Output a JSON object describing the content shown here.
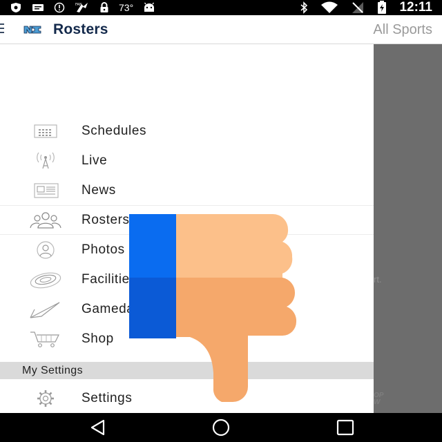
{
  "status_bar": {
    "temperature": "73°",
    "time": "12:11",
    "icons": [
      "shield-icon",
      "message-icon",
      "alert-icon",
      "fantasy-icon",
      "lock-icon",
      "android-icon",
      "bluetooth-icon",
      "wifi-icon",
      "signal-icon",
      "battery-icon"
    ]
  },
  "app_bar": {
    "title": "Rosters",
    "action": "All Sports",
    "logo": "unc-logo-icon"
  },
  "drawer": {
    "items": [
      {
        "label": "Schedules",
        "icon": "calendar-icon"
      },
      {
        "label": "Live",
        "icon": "broadcast-antenna-icon"
      },
      {
        "label": "News",
        "icon": "newspaper-icon"
      },
      {
        "label": "Rosters",
        "icon": "people-icon",
        "active": true
      },
      {
        "label": "Photos",
        "icon": "photo-person-icon"
      },
      {
        "label": "Facilities",
        "icon": "stadium-icon"
      },
      {
        "label": "Gameday",
        "icon": "pennant-icon"
      },
      {
        "label": "Shop",
        "icon": "shopping-cart-icon"
      }
    ],
    "section_header": "My Settings",
    "settings_item": {
      "label": "Settings",
      "icon": "gear-icon"
    }
  },
  "background_fragments": {
    "text_1": "rt.",
    "text_2": "OP\nW"
  },
  "overlay": {
    "icon": "thumbs-down-icon",
    "colors": {
      "cuff": "#0a6cf0",
      "cuff_shadow": "#0b5ad6",
      "hand": "#fcc08a",
      "hand_shadow": "#f5a86b"
    }
  },
  "nav_bar": {
    "icons": [
      "back-icon",
      "home-icon",
      "recents-icon"
    ]
  },
  "colors": {
    "brand_navy": "#13294b",
    "brand_blue": "#4b9cd3",
    "action_gray": "#9a9a9a"
  }
}
